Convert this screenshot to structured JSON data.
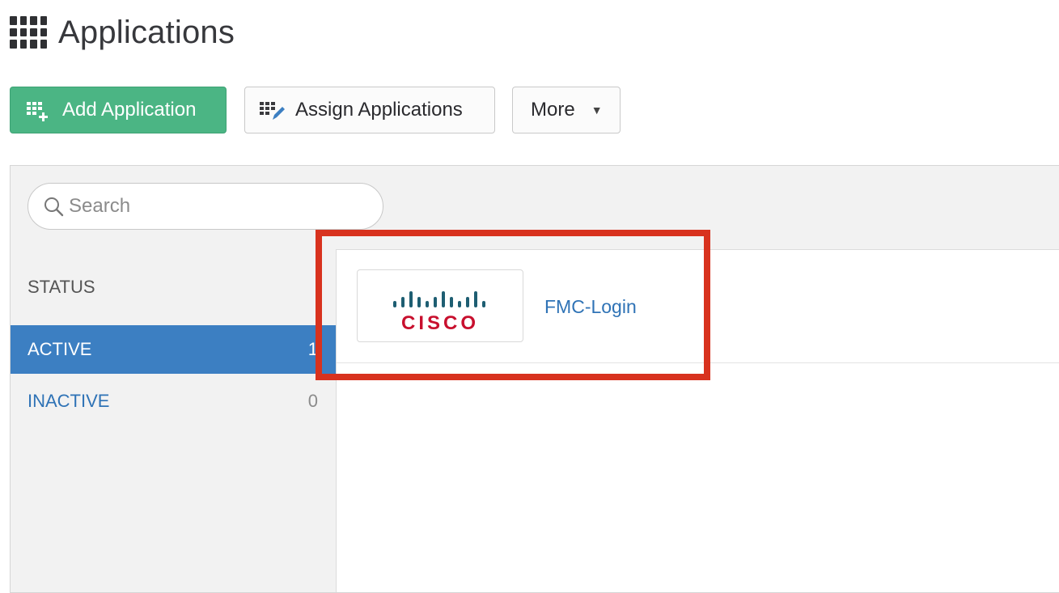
{
  "page": {
    "title": "Applications",
    "title_icon": "app-grid-icon"
  },
  "toolbar": {
    "add_label": "Add Application",
    "add_icon": "add-app-grid-icon",
    "assign_label": "Assign Applications",
    "assign_icon": "assign-app-grid-icon",
    "more_label": "More",
    "more_icon": "chevron-down-icon"
  },
  "search": {
    "placeholder": "Search",
    "icon": "search-icon"
  },
  "sidebar": {
    "status_label": "STATUS",
    "items": [
      {
        "label": "ACTIVE",
        "count": "1",
        "selected": true
      },
      {
        "label": "INACTIVE",
        "count": "0",
        "selected": false
      }
    ]
  },
  "apps": [
    {
      "name": "FMC-Login",
      "logo_text": "CISCO"
    }
  ],
  "colors": {
    "accent_green": "#4bb584",
    "active_blue": "#3c7fc2",
    "link_blue": "#2f73b6",
    "highlight_red": "#d8321e",
    "cisco_teal": "#1e5e72",
    "cisco_red": "#c8102e"
  }
}
